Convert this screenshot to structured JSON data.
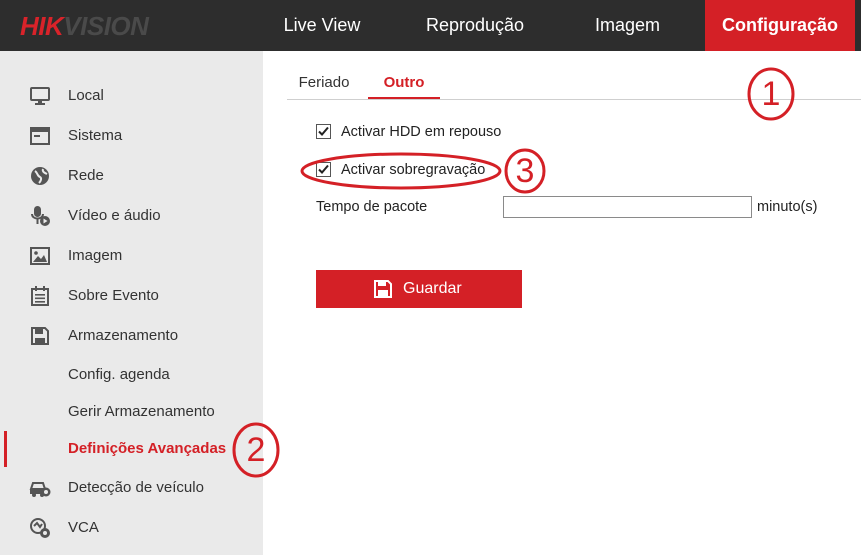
{
  "brand": {
    "part1": "HIK",
    "part2": "VISION"
  },
  "nav": {
    "items": [
      {
        "label": "Live View"
      },
      {
        "label": "Reprodução"
      },
      {
        "label": "Imagem"
      },
      {
        "label": "Configuração",
        "active": true
      }
    ]
  },
  "sidebar": {
    "items": [
      {
        "label": "Local",
        "icon": "monitor-icon"
      },
      {
        "label": "Sistema",
        "icon": "window-icon"
      },
      {
        "label": "Rede",
        "icon": "globe-icon"
      },
      {
        "label": "Vídeo e áudio",
        "icon": "microphone-icon"
      },
      {
        "label": "Imagem",
        "icon": "image-icon"
      },
      {
        "label": "Sobre Evento",
        "icon": "calendar-icon"
      },
      {
        "label": "Armazenamento",
        "icon": "floppy-disk-icon"
      },
      {
        "label": "Config. agenda"
      },
      {
        "label": "Gerir Armazenamento"
      },
      {
        "label": "Definições Avançadas",
        "active": true
      },
      {
        "label": "Detecção de veículo",
        "icon": "vehicle-icon"
      },
      {
        "label": "VCA",
        "icon": "vca-icon"
      }
    ]
  },
  "tabs": [
    {
      "label": "Feriado"
    },
    {
      "label": "Outro",
      "active": true
    }
  ],
  "form": {
    "hdd_sleep": {
      "label": "Activar HDD em repouso",
      "checked": true
    },
    "overwrite": {
      "label": "Activar sobregravação",
      "checked": true
    },
    "packet_time": {
      "label": "Tempo de pacote",
      "value": "",
      "unit": "minuto(s)"
    },
    "save_label": "Guardar"
  },
  "annotations": [
    "1",
    "2",
    "3"
  ],
  "colors": {
    "accent": "#d42026",
    "topbar": "#2d2d2d",
    "sidebar": "#eaeaea"
  }
}
